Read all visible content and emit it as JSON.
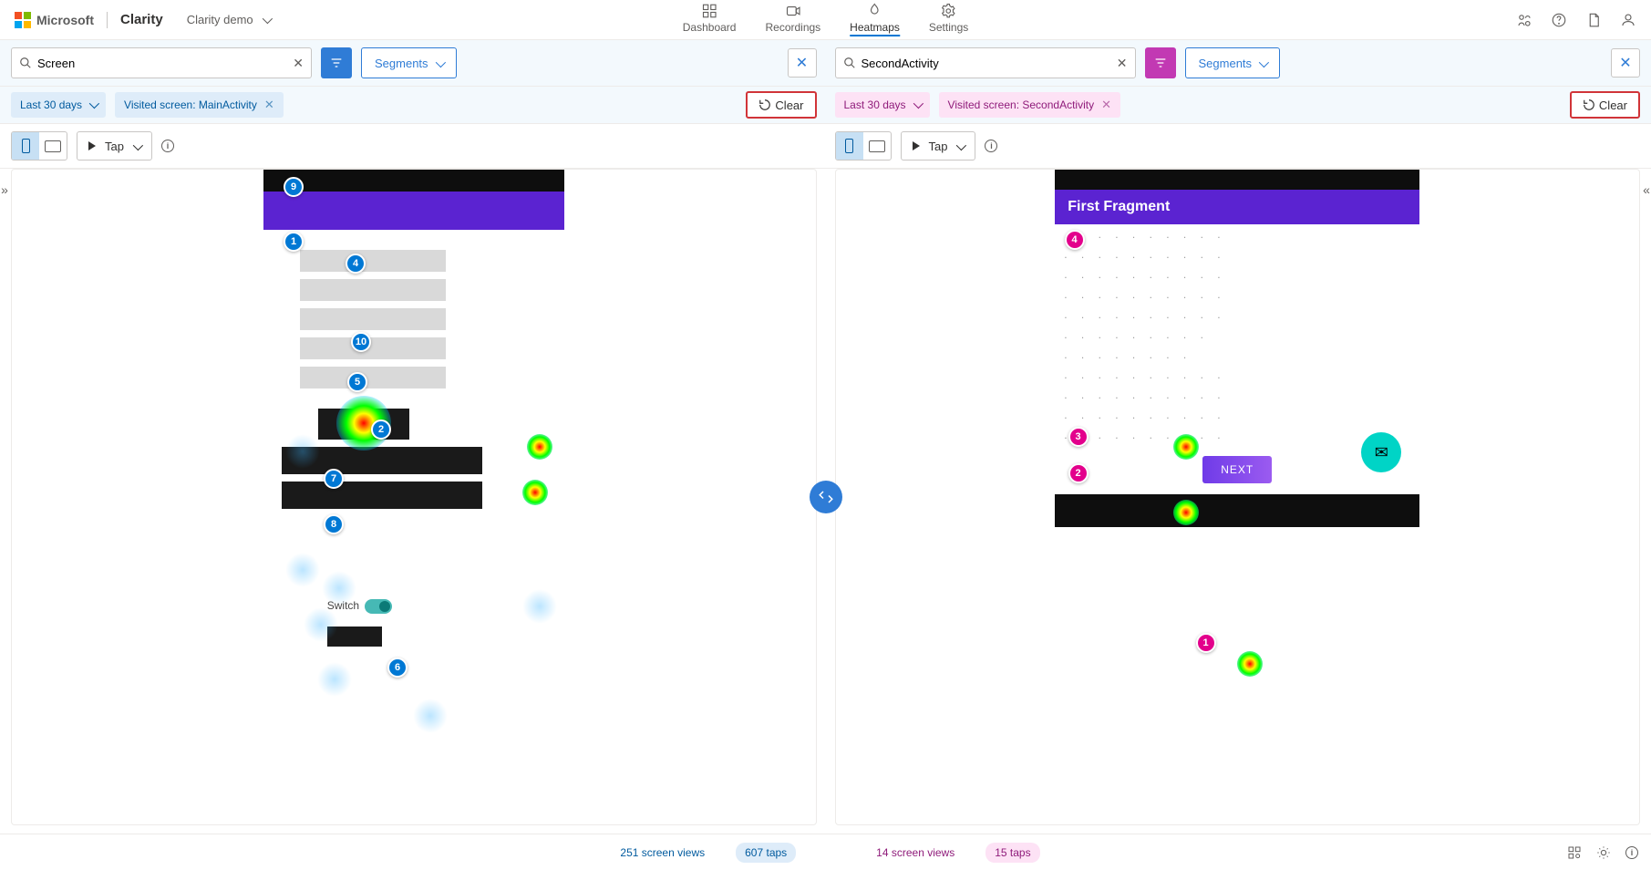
{
  "header": {
    "ms": "Microsoft",
    "brand": "Clarity",
    "project": "Clarity demo"
  },
  "nav": {
    "dashboard": "Dashboard",
    "recordings": "Recordings",
    "heatmaps": "Heatmaps",
    "settings": "Settings"
  },
  "left": {
    "search_value": "Screen",
    "segments": "Segments",
    "chip_date": "Last 30 days",
    "chip_screen": "Visited screen: MainActivity",
    "clear": "Clear",
    "tap": "Tap",
    "stats_views": "251 screen views",
    "stats_taps": "607 taps",
    "pins": [
      "1",
      "2",
      "4",
      "5",
      "6",
      "7",
      "8",
      "9",
      "10"
    ],
    "switch_label": "Switch"
  },
  "right": {
    "search_value": "SecondActivity",
    "segments": "Segments",
    "chip_date": "Last 30 days",
    "chip_screen": "Visited screen: SecondActivity",
    "clear": "Clear",
    "tap": "Tap",
    "stats_views": "14 screen views",
    "stats_taps": "15 taps",
    "fragment_title": "First Fragment",
    "next_label": "NEXT",
    "pins": [
      "1",
      "2",
      "3",
      "4"
    ]
  }
}
